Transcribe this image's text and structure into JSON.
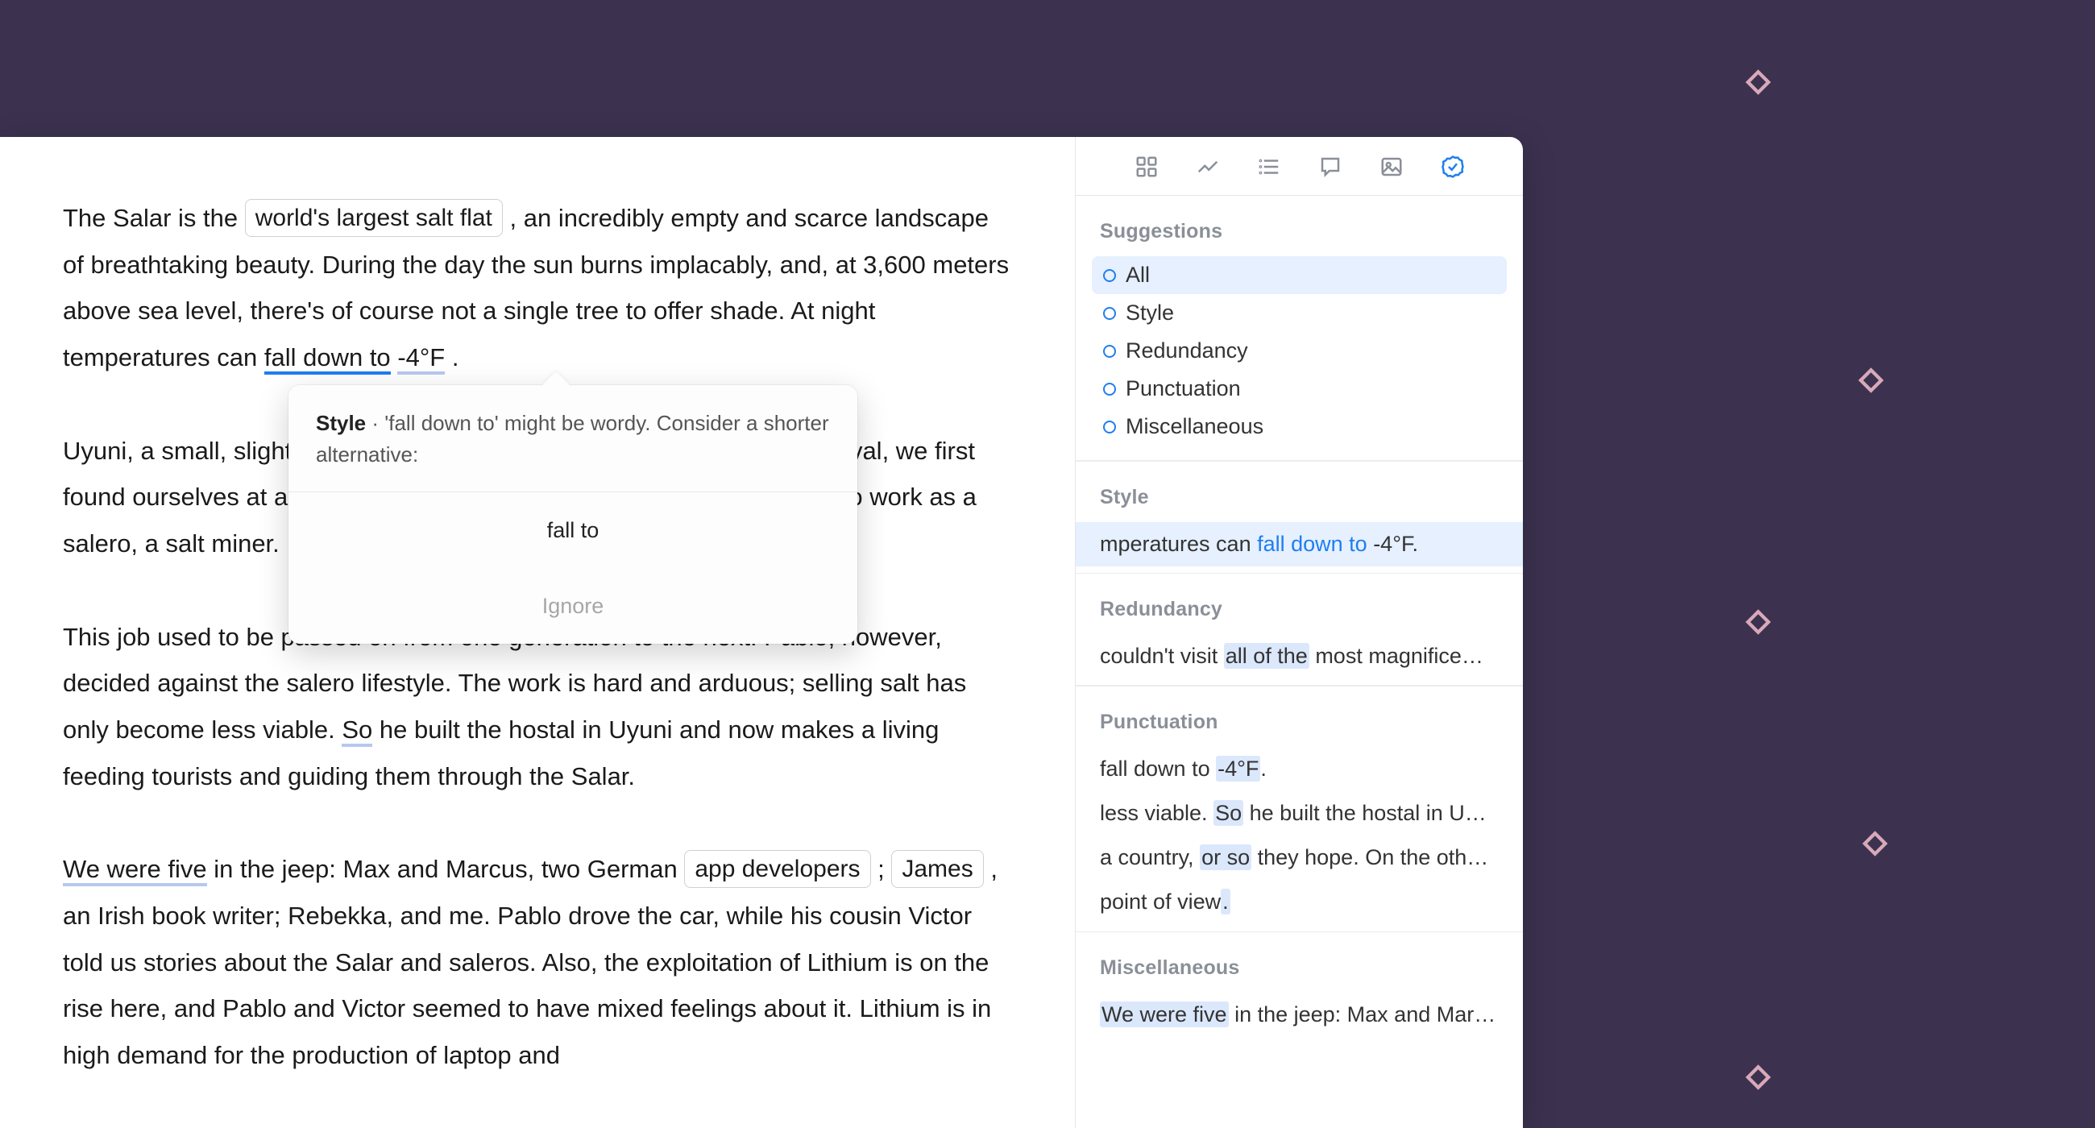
{
  "toolbar_icons": [
    "grid",
    "trend",
    "list",
    "comment",
    "image",
    "check"
  ],
  "editor": {
    "p1_a": "The Salar is the ",
    "p1_pill1": "world's largest salt flat",
    "p1_b": ", an incredibly empty and scarce landscape of breathtaking beauty. During the day the sun burns implacably, and, at 3,600 meters above sea level, there's of course not a single tree to offer shade. At night temperatures can ",
    "p1_ul1": "fall down to",
    "p1_sp": " ",
    "p1_ul2": "-4°F",
    "p1_c": ".",
    "p2": "Uyuni, a small, slightly rough town, is your base for exploring. Upon arrival, we first found ourselves at a hostal owned by Pablo, a humble local who used to work as a salero, a salt miner.",
    "p3_a": "This job used to be passed on from one generation to the next. Pablo, however, decided against the salero lifestyle. The work is hard and arduous; selling salt has only become less viable. ",
    "p3_ul": "So",
    "p3_b": " he built the hostal in Uyuni and now makes a living feeding tourists and guiding them through the Salar.",
    "p4_ul1": "We were five",
    "p4_a": " in the jeep: Max and Marcus, two German ",
    "p4_pill1": "app developers",
    "p4_b": " ; ",
    "p4_pill2": "James",
    "p4_c": " , an Irish book writer; Rebekka, and me. Pablo drove the car, while his cousin Victor told us stories about the Salar and saleros. Also, the exploitation of Lithium is on the rise here, and Pablo and Victor seemed to have mixed feelings about it. Lithium is in high demand for the production of laptop and"
  },
  "popover": {
    "category": "Style",
    "dot": " · ",
    "text": "'fall down to' might be wordy. Consider a shorter alternative:",
    "suggestion": "fall to",
    "ignore": "Ignore"
  },
  "sidebar": {
    "suggestions_title": "Suggestions",
    "filters": {
      "all": "All",
      "style": "Style",
      "redundancy": "Redundancy",
      "punctuation": "Punctuation",
      "miscellaneous": "Miscellaneous"
    },
    "groups": {
      "style": {
        "title": "Style",
        "items": [
          {
            "pre": "mperatures can ",
            "hl": "fall down to",
            "post": " -4°F."
          }
        ]
      },
      "redundancy": {
        "title": "Redundancy",
        "items": [
          {
            "pre": "couldn't visit ",
            "hl": "all of the",
            "post": " most magnifice…"
          }
        ]
      },
      "punctuation": {
        "title": "Punctuation",
        "items": [
          {
            "pre": "fall down to ",
            "hl": "-4°F",
            "post": "."
          },
          {
            "pre": "less viable. ",
            "hl": "So",
            "post": " he built the hostal in U…"
          },
          {
            "pre": "a country, ",
            "hl": "or so",
            "post": " they hope. On the oth…"
          },
          {
            "pre": "point of view",
            "hl": ".",
            "post": ""
          }
        ]
      },
      "miscellaneous": {
        "title": "Miscellaneous",
        "items": [
          {
            "pre": "",
            "hl": "We were five",
            "post": " in the jeep: Max and Mar…"
          }
        ]
      }
    }
  }
}
